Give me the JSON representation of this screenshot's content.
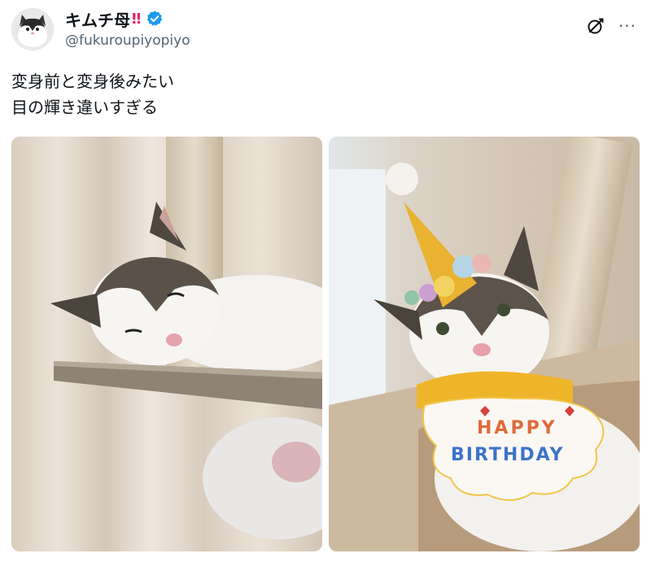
{
  "author": {
    "display_name": "キムチ母",
    "name_emoji": "‼",
    "handle": "@fukuroupiyopiyo",
    "verified": true,
    "avatar_icon": "cat-avatar"
  },
  "tweet": {
    "lines": [
      "変身前と変身後みたい",
      "目の輝き違いすぎる"
    ]
  },
  "actions": {
    "grok_icon": "grok-icon",
    "more_label": "···"
  },
  "media": {
    "right_photo_bib_line1": "HAPPY",
    "right_photo_bib_line2": "BIRTHDAY"
  },
  "colors": {
    "verified_blue": "#1d9bf0",
    "text_primary": "#0f1419",
    "text_secondary": "#536471",
    "emoji_red": "#e0245e"
  }
}
